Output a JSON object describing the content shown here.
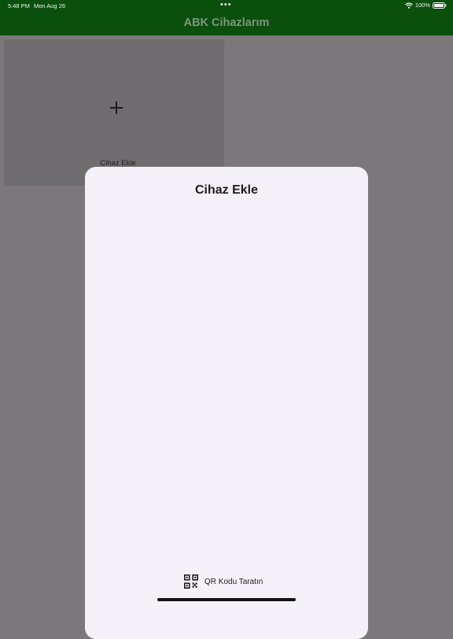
{
  "status_bar": {
    "time": "5:48 PM",
    "date": "Mon Aug 26",
    "more_dots": "•••",
    "battery": "100%"
  },
  "header": {
    "title": "ABK Cihazlarım"
  },
  "add_tile": {
    "label": "Cihaz Ekle",
    "icon": "plus-icon"
  },
  "sheet": {
    "title": "Cihaz Ekle",
    "qr_button_label": "QR Kodu Taratın",
    "qr_icon": "qr-code-icon"
  },
  "colors": {
    "header_bg": "#0b4f0c",
    "overlay_bg": "#7c777b",
    "sheet_bg": "#f4f1f8"
  }
}
